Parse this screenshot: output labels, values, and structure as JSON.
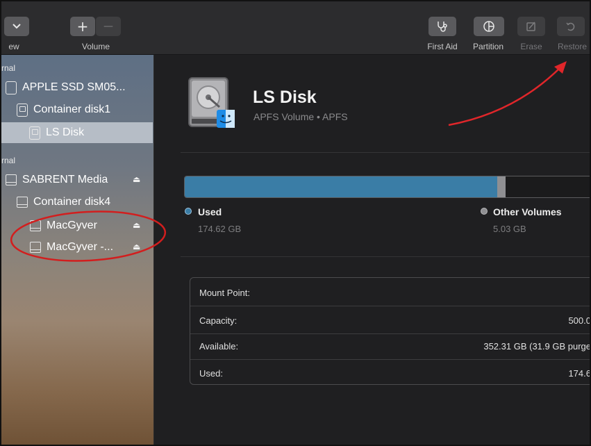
{
  "toolbar": {
    "view_label": "ew",
    "volume_label": "Volume",
    "add_glyph": "+",
    "remove_glyph": "—",
    "first_aid_label": "First Aid",
    "partition_label": "Partition",
    "erase_label": "Erase",
    "restore_label": "Restore"
  },
  "sidebar": {
    "internal_label": "rnal",
    "external_label": "rnal",
    "internal_items": [
      {
        "name": "APPLE SSD SM05...",
        "icon": "internal-disk-icon"
      },
      {
        "name": "Container disk1",
        "icon": "container-icon"
      },
      {
        "name": "LS Disk",
        "icon": "volume-icon",
        "selected": true
      }
    ],
    "external_items": [
      {
        "name": "SABRENT Media",
        "icon": "external-disk-icon",
        "eject": true
      },
      {
        "name": "Container disk4",
        "icon": "container-icon"
      },
      {
        "name": "MacGyver",
        "icon": "volume-icon",
        "eject": true
      },
      {
        "name": "MacGyver -...",
        "icon": "volume-icon",
        "eject": true
      }
    ],
    "eject_glyph": "⏏"
  },
  "volume": {
    "name": "LS Disk",
    "subtitle": "APFS Volume • APFS"
  },
  "usage": {
    "used_label": "Used",
    "used_value": "174.62 GB",
    "other_label": "Other Volumes",
    "other_value": "5.03 GB",
    "used_fraction": 0.7625,
    "other_fraction": 0.02,
    "used_color": "#3a7da6",
    "other_color": "#8f8f92"
  },
  "info": {
    "rows": [
      {
        "key": "Mount Point:",
        "value": ""
      },
      {
        "key": "Capacity:",
        "value": "500.0"
      },
      {
        "key": "Available:",
        "value": "352.31 GB (31.9 GB purge"
      },
      {
        "key": "Used:",
        "value": "174.6"
      }
    ]
  },
  "annotations": {
    "ellipse_color": "#d21e1e",
    "arrow_color": "#e0262a"
  }
}
